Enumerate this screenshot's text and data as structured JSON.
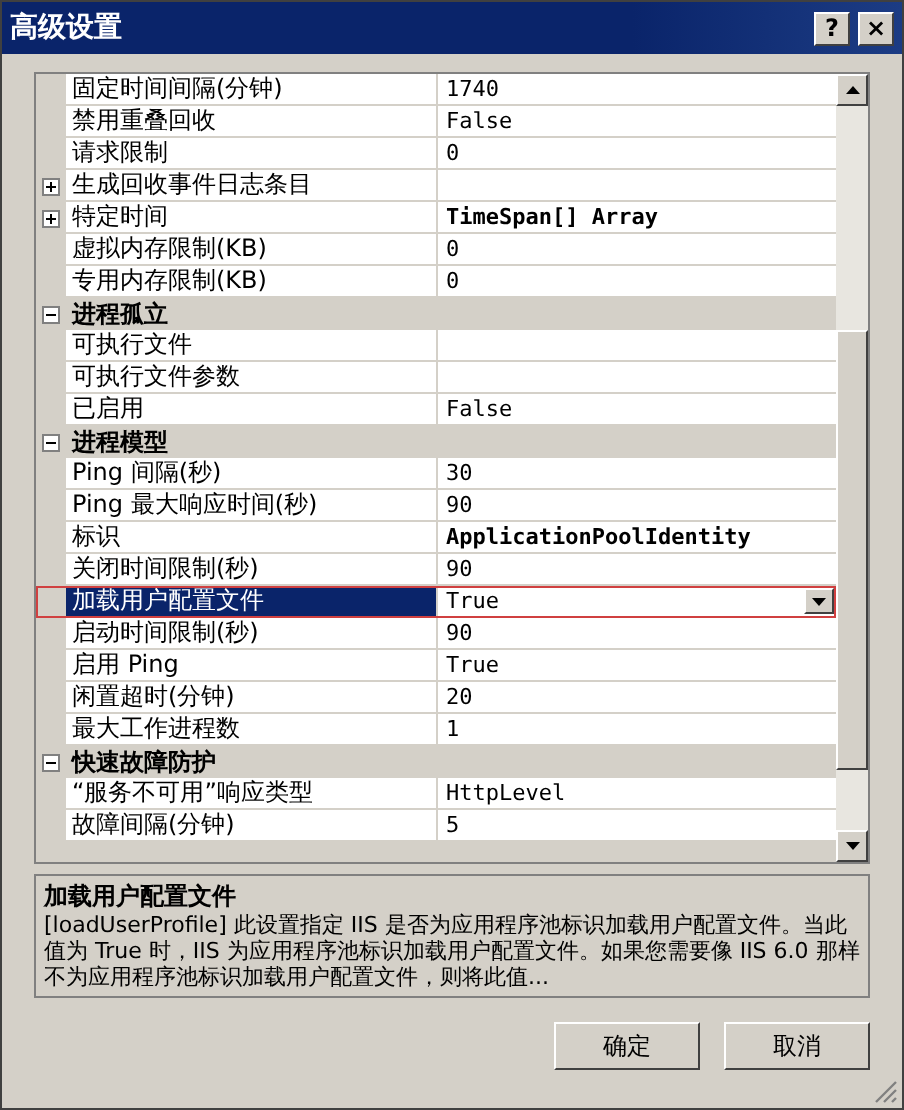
{
  "window": {
    "title": "高级设置"
  },
  "title_buttons": [
    {
      "kind": "help",
      "label": "?"
    },
    {
      "kind": "close",
      "label": "×"
    }
  ],
  "grid": {
    "rows": [
      {
        "kind": "property",
        "name": "固定时间间隔(分钟)",
        "value": "1740",
        "bold": false,
        "expandable": false,
        "selected": false
      },
      {
        "kind": "property",
        "name": "禁用重叠回收",
        "value": "False",
        "bold": false,
        "expandable": false,
        "selected": false
      },
      {
        "kind": "property",
        "name": "请求限制",
        "value": "0",
        "bold": false,
        "expandable": false,
        "selected": false
      },
      {
        "kind": "property",
        "name": "生成回收事件日志条目",
        "expandable": true,
        "selected": false
      },
      {
        "kind": "property",
        "name": "特定时间",
        "value": "TimeSpan[] Array",
        "bold": true,
        "expandable": true,
        "selected": false
      },
      {
        "kind": "property",
        "name": "虚拟内存限制(KB)",
        "value": "0",
        "bold": false,
        "expandable": false,
        "selected": false
      },
      {
        "kind": "property",
        "name": "专用内存限制(KB)",
        "value": "0",
        "bold": false,
        "expandable": false,
        "selected": false
      },
      {
        "kind": "category",
        "name": "进程孤立",
        "expanded": true
      },
      {
        "kind": "property",
        "name": "可执行文件",
        "expandable": false,
        "selected": false
      },
      {
        "kind": "property",
        "name": "可执行文件参数",
        "expandable": false,
        "selected": false
      },
      {
        "kind": "property",
        "name": "已启用",
        "value": "False",
        "bold": false,
        "expandable": false,
        "selected": false
      },
      {
        "kind": "category",
        "name": "进程模型",
        "expanded": true
      },
      {
        "kind": "property",
        "name": "Ping 间隔(秒)",
        "value": "30",
        "bold": false,
        "expandable": false,
        "selected": false
      },
      {
        "kind": "property",
        "name": "Ping 最大响应时间(秒)",
        "value": "90",
        "bold": false,
        "expandable": false,
        "selected": false
      },
      {
        "kind": "property",
        "name": "标识",
        "value": "ApplicationPoolIdentity",
        "bold": true,
        "expandable": false,
        "selected": false
      },
      {
        "kind": "property",
        "name": "关闭时间限制(秒)",
        "value": "90",
        "bold": false,
        "expandable": false,
        "selected": false
      },
      {
        "kind": "property",
        "name": "加载用户配置文件",
        "value": "True",
        "bold": false,
        "expandable": false,
        "selected": true
      },
      {
        "kind": "property",
        "name": "启动时间限制(秒)",
        "value": "90",
        "bold": false,
        "expandable": false,
        "selected": false
      },
      {
        "kind": "property",
        "name": "启用 Ping",
        "value": "True",
        "bold": false,
        "expandable": false,
        "selected": false
      },
      {
        "kind": "property",
        "name": "闲置超时(分钟)",
        "value": "20",
        "bold": false,
        "expandable": false,
        "selected": false
      },
      {
        "kind": "property",
        "name": "最大工作进程数",
        "value": "1",
        "bold": false,
        "expandable": false,
        "selected": false
      },
      {
        "kind": "category",
        "name": "快速故障防护",
        "expanded": true
      },
      {
        "kind": "property",
        "name": "“服务不可用”响应类型",
        "value": "HttpLevel",
        "bold": false,
        "expandable": false,
        "selected": false
      },
      {
        "kind": "property",
        "name": "故障间隔(分钟)",
        "value": "5",
        "bold": false,
        "expandable": false,
        "selected": false
      }
    ]
  },
  "description": {
    "title": "加载用户配置文件",
    "text": "[loadUserProfile] 此设置指定 IIS 是否为应用程序池标识加载用户配置文件。当此值为 True 时，IIS 为应用程序池标识加载用户配置文件。如果您需要像 IIS 6.0 那样不为应用程序池标识加载用户配置文件，则将此值..."
  },
  "buttons": [
    {
      "label": "确定"
    },
    {
      "label": "取消"
    }
  ]
}
